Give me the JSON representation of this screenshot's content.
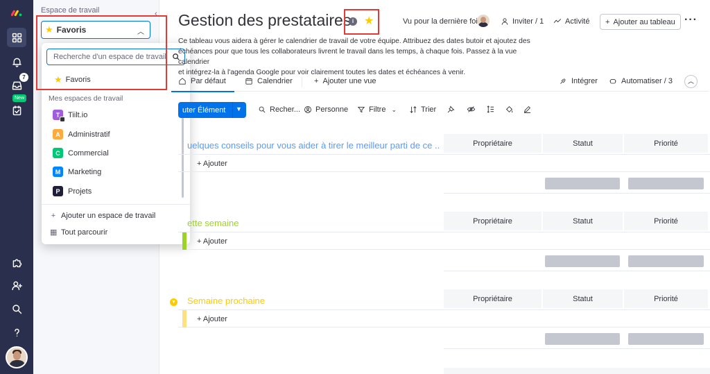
{
  "rail": {
    "inbox_badge": "7",
    "my_work_badge": "New"
  },
  "workspace": {
    "label": "Espace de travail",
    "selected": "Favoris"
  },
  "dropdown": {
    "search_placeholder": "Recherche d'un espace de travail",
    "favorites": "Favoris",
    "section_label": "Mes espaces de travail",
    "workspaces": [
      {
        "letter": "T",
        "name": "Tiilt.io",
        "color": "#a25ddc"
      },
      {
        "letter": "A",
        "name": "Administratif",
        "color": "#fdab3d"
      },
      {
        "letter": "C",
        "name": "Commercial",
        "color": "#00c875"
      },
      {
        "letter": "M",
        "name": "Marketing",
        "color": "#0086ff"
      },
      {
        "letter": "P",
        "name": "Projets",
        "color": "#1f1f3a"
      }
    ],
    "add_workspace": "Ajouter un espace de travail",
    "browse_all": "Tout parcourir"
  },
  "board": {
    "title": "Gestion des prestataires",
    "last_seen": "Vu pour la dernière fois",
    "invite": "Inviter / 1",
    "activity": "Activité",
    "add_to_board": "Ajouter au tableau",
    "description_lines": [
      "Ce tableau vous aidera à gérer le calendrier de travail de votre équipe. Attribuez des dates butoir et ajoutez des",
      "échéances pour que tous les collaborateurs livrent le travail dans les temps, à chaque fois. Passez à la vue calendrier",
      "et intégrez-la à l'agenda Google pour voir clairement toutes les dates et échéances à venir."
    ]
  },
  "tabs": {
    "default_view": "Par défaut",
    "calendar": "Calendrier",
    "add_view": "Ajouter une vue",
    "integrate": "Intégrer",
    "automate": "Automatiser / 3"
  },
  "toolbar": {
    "new_item": "uter Élément",
    "search": "Recher...",
    "person": "Personne",
    "filter": "Filtre",
    "sort": "Trier"
  },
  "columns": {
    "owner": "Propriétaire",
    "status": "Statut",
    "priority": "Priorité"
  },
  "groups": [
    {
      "title": "uelques conseils pour vous aider à tirer le meilleur parti de ce ...",
      "color": "#579bfc",
      "add_label": "+ Ajouter"
    },
    {
      "title": "ette semaine",
      "color": "#9cd326",
      "add_label": "+ Ajouter"
    },
    {
      "title": "Semaine prochaine",
      "color": "#ffcb00",
      "add_label": "+ Ajouter"
    }
  ],
  "colors": {
    "accent": "#0073ea",
    "rail_bg": "#292f4c",
    "highlight": "#e53935",
    "favorite_star": "#ffcb00"
  }
}
